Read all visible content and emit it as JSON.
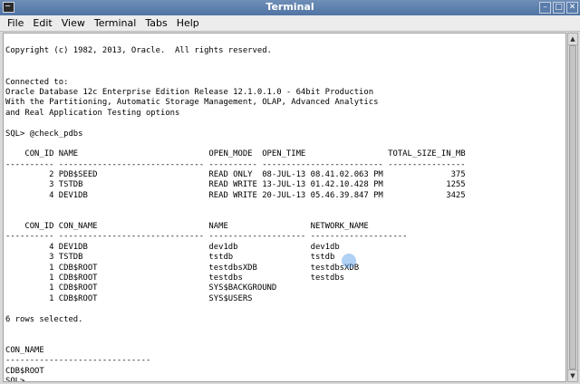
{
  "window": {
    "title": "Terminal",
    "buttons": {
      "minimize": "–",
      "maximize": "□",
      "close": "✕"
    },
    "icon": "terminal-icon"
  },
  "menu": [
    "File",
    "Edit",
    "View",
    "Terminal",
    "Tabs",
    "Help"
  ],
  "terminal": {
    "lines": [
      "",
      "Copyright (c) 1982, 2013, Oracle.  All rights reserved.",
      "",
      "",
      "Connected to:",
      "Oracle Database 12c Enterprise Edition Release 12.1.0.1.0 - 64bit Production",
      "With the Partitioning, Automatic Storage Management, OLAP, Advanced Analytics",
      "and Real Application Testing options",
      "",
      "SQL> @check_pdbs",
      "",
      "    CON_ID NAME                           OPEN_MODE  OPEN_TIME                 TOTAL_SIZE_IN_MB",
      "---------- ------------------------------ ---------- ------------------------- ----------------",
      "         2 PDB$SEED                       READ ONLY  08-JUL-13 08.41.02.063 PM              375",
      "         3 TSTDB                          READ WRITE 13-JUL-13 01.42.10.428 PM             1255",
      "         4 DEV1DB                         READ WRITE 20-JUL-13 05.46.39.847 PM             3425",
      "",
      "",
      "    CON_ID CON_NAME                       NAME                 NETWORK_NAME",
      "---------- ------------------------------ -------------------- --------------------",
      "         4 DEV1DB                         dev1db               dev1db",
      "         3 TSTDB                          tstdb                tstdb",
      "         1 CDB$ROOT                       testdbsXDB           testdbsXDB",
      "         1 CDB$ROOT                       testdbs              testdbs",
      "         1 CDB$ROOT                       SYS$BACKGROUND",
      "         1 CDB$ROOT                       SYS$USERS",
      "",
      "6 rows selected.",
      "",
      "",
      "CON_NAME",
      "------------------------------",
      "CDB$ROOT",
      "SQL> "
    ]
  }
}
